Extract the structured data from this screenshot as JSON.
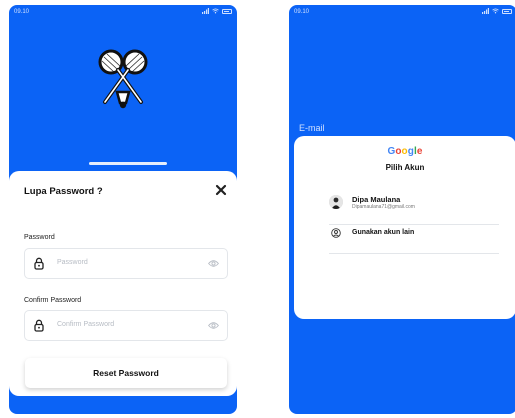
{
  "left_screen": {
    "status": {
      "time": "09.10"
    },
    "sheet": {
      "title": "Lupa Password ?",
      "password_label": "Password",
      "password_placeholder": "Password",
      "confirm_label": "Confirm Password",
      "confirm_placeholder": "Confirm Password",
      "reset_button": "Reset Password"
    }
  },
  "right_screen": {
    "status": {
      "time": "09.10"
    },
    "email_label": "E-mail",
    "google": {
      "wordmark": [
        "G",
        "o",
        "o",
        "g",
        "l",
        "e"
      ],
      "wordmark_colors": [
        "#4285F4",
        "#EA4335",
        "#FBBC05",
        "#4285F4",
        "#34A853",
        "#EA4335"
      ],
      "title": "Pilih Akun",
      "account_name": "Dipa Maulana",
      "account_email": "Dipamaulana71@gmail.com",
      "other_account": "Gunakan akun lain"
    }
  },
  "colors": {
    "brand_blue": "#0B63F6"
  },
  "icons": [
    "badminton-logo-icon",
    "close-icon",
    "lock-icon",
    "eye-icon",
    "account-circle-icon",
    "signal-icon",
    "wifi-icon",
    "battery-icon"
  ]
}
